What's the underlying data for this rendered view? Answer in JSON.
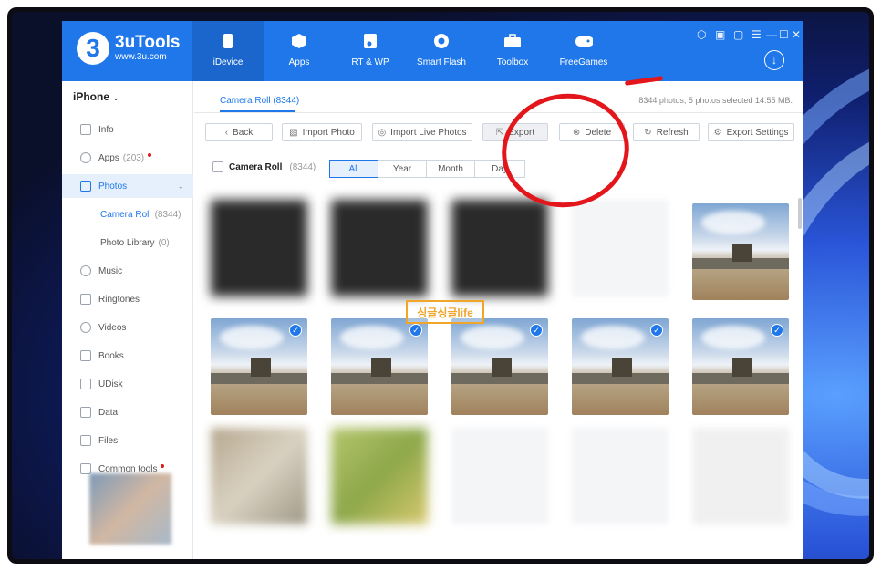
{
  "app": {
    "name": "3uTools",
    "url": "www.3u.com",
    "logo_char": "3"
  },
  "nav": [
    {
      "label": "iDevice",
      "icon": "phone-icon"
    },
    {
      "label": "Apps",
      "icon": "cube-icon"
    },
    {
      "label": "RT & WP",
      "icon": "music-file-icon"
    },
    {
      "label": "Smart Flash",
      "icon": "flash-icon"
    },
    {
      "label": "Toolbox",
      "icon": "toolbox-icon"
    },
    {
      "label": "FreeGames",
      "icon": "gamepad-icon"
    }
  ],
  "sidebar": {
    "device": "iPhone",
    "items": [
      {
        "label": "Info"
      },
      {
        "label": "Apps",
        "count": "(203)"
      },
      {
        "label": "Photos"
      },
      {
        "label": "Camera Roll",
        "count": "(8344)"
      },
      {
        "label": "Photo Library",
        "count": "(0)"
      },
      {
        "label": "Music"
      },
      {
        "label": "Ringtones"
      },
      {
        "label": "Videos"
      },
      {
        "label": "Books"
      },
      {
        "label": "UDisk"
      },
      {
        "label": "Data"
      },
      {
        "label": "Files"
      },
      {
        "label": "Common tools"
      }
    ]
  },
  "main": {
    "breadcrumb": "Camera Roll (8344)",
    "info": "8344 photos, 5 photos selected 14.55 MB.",
    "toolbar": {
      "back": "Back",
      "import_photo": "Import Photo",
      "import_live": "Import Live Photos",
      "export": "Export",
      "delete": "Delete",
      "refresh": "Refresh",
      "export_settings": "Export Settings"
    },
    "selection": {
      "label": "Camera Roll",
      "count": "(8344)"
    },
    "segments": [
      "All",
      "Year",
      "Month",
      "Day"
    ],
    "watermark": "싱글싱글life"
  },
  "colors": {
    "brand": "#1f77ea",
    "annotation": "#e3161c"
  }
}
